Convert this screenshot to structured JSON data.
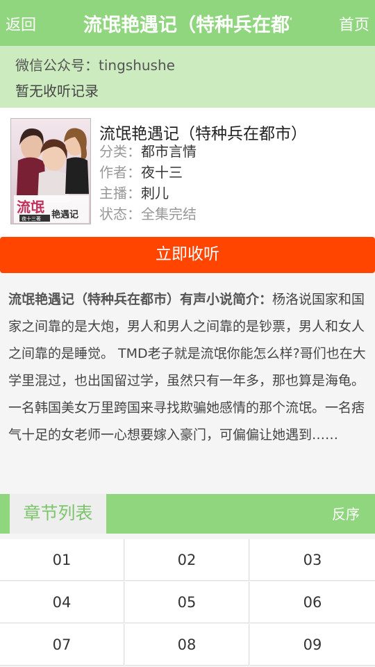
{
  "header": {
    "back_label": "返回",
    "title": "流氓艳遇记（特种兵在都市）",
    "home_label": "首页"
  },
  "notice": {
    "wechat": "微信公众号：tingshushe",
    "history": "暂无收听记录"
  },
  "book": {
    "title": "流氓艳遇记（特种兵在都市）",
    "category_label": "分类：",
    "category": "都市言情",
    "author_label": "作者：",
    "author": "夜十三",
    "narrator_label": "主播：",
    "narrator": "刺儿",
    "status_label": "状态：",
    "status": "全集完结",
    "cover_text": "流氓艳遇记",
    "cover_author": "夜十三著"
  },
  "actions": {
    "listen_now": "立即收听"
  },
  "intro": {
    "label": "流氓艳遇记（特种兵在都市）有声小说简介：",
    "text": "杨洛说国家和国家之间靠的是大炮，男人和男人之间靠的是钞票，男人和女人之间靠的是睡觉。 TMD老子就是流氓你能怎么样?哥们也在大学里混过，也出国留过学，虽然只有一年多，那也算是海龟。一名韩国美女万里跨国来寻找欺骗她感情的那个流氓。一名痞气十足的女老师一心想要嫁入豪门，可偏偏让她遇到……"
  },
  "chapters": {
    "tab_label": "章节列表",
    "reverse_label": "反序",
    "items": [
      "01",
      "02",
      "03",
      "04",
      "05",
      "06",
      "07",
      "08",
      "09"
    ]
  },
  "colors": {
    "primary_green": "#8fd67e",
    "light_green": "#ccecbf",
    "accent_orange": "#ff4500"
  }
}
